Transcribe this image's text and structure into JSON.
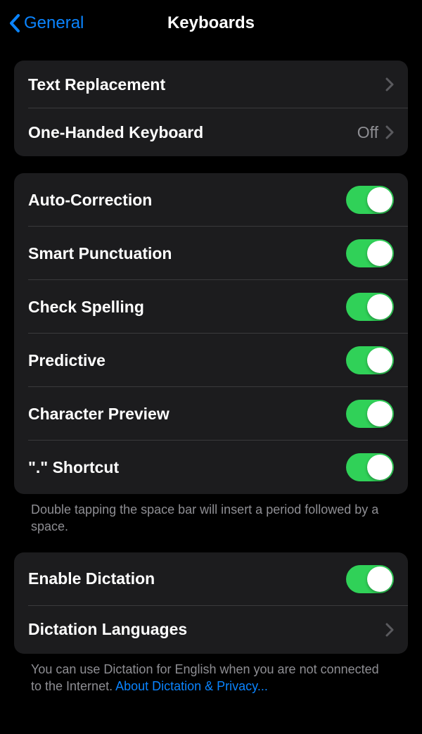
{
  "header": {
    "back_label": "General",
    "title": "Keyboards"
  },
  "sections": {
    "first": {
      "text_replacement": "Text Replacement",
      "one_handed": "One-Handed Keyboard",
      "one_handed_value": "Off"
    },
    "typing": {
      "auto_correction": "Auto-Correction",
      "smart_punctuation": "Smart Punctuation",
      "check_spelling": "Check Spelling",
      "predictive": "Predictive",
      "character_preview": "Character Preview",
      "period_shortcut": "\".\" Shortcut",
      "footer": "Double tapping the space bar will insert a period followed by a space."
    },
    "dictation": {
      "enable_dictation": "Enable Dictation",
      "dictation_languages": "Dictation Languages",
      "footer_text": "You can use Dictation for English when you are not connected to the Internet. ",
      "footer_link": "About Dictation & Privacy..."
    }
  },
  "toggles": {
    "auto_correction": true,
    "smart_punctuation": true,
    "check_spelling": true,
    "predictive": true,
    "character_preview": true,
    "period_shortcut": true,
    "enable_dictation": true
  }
}
